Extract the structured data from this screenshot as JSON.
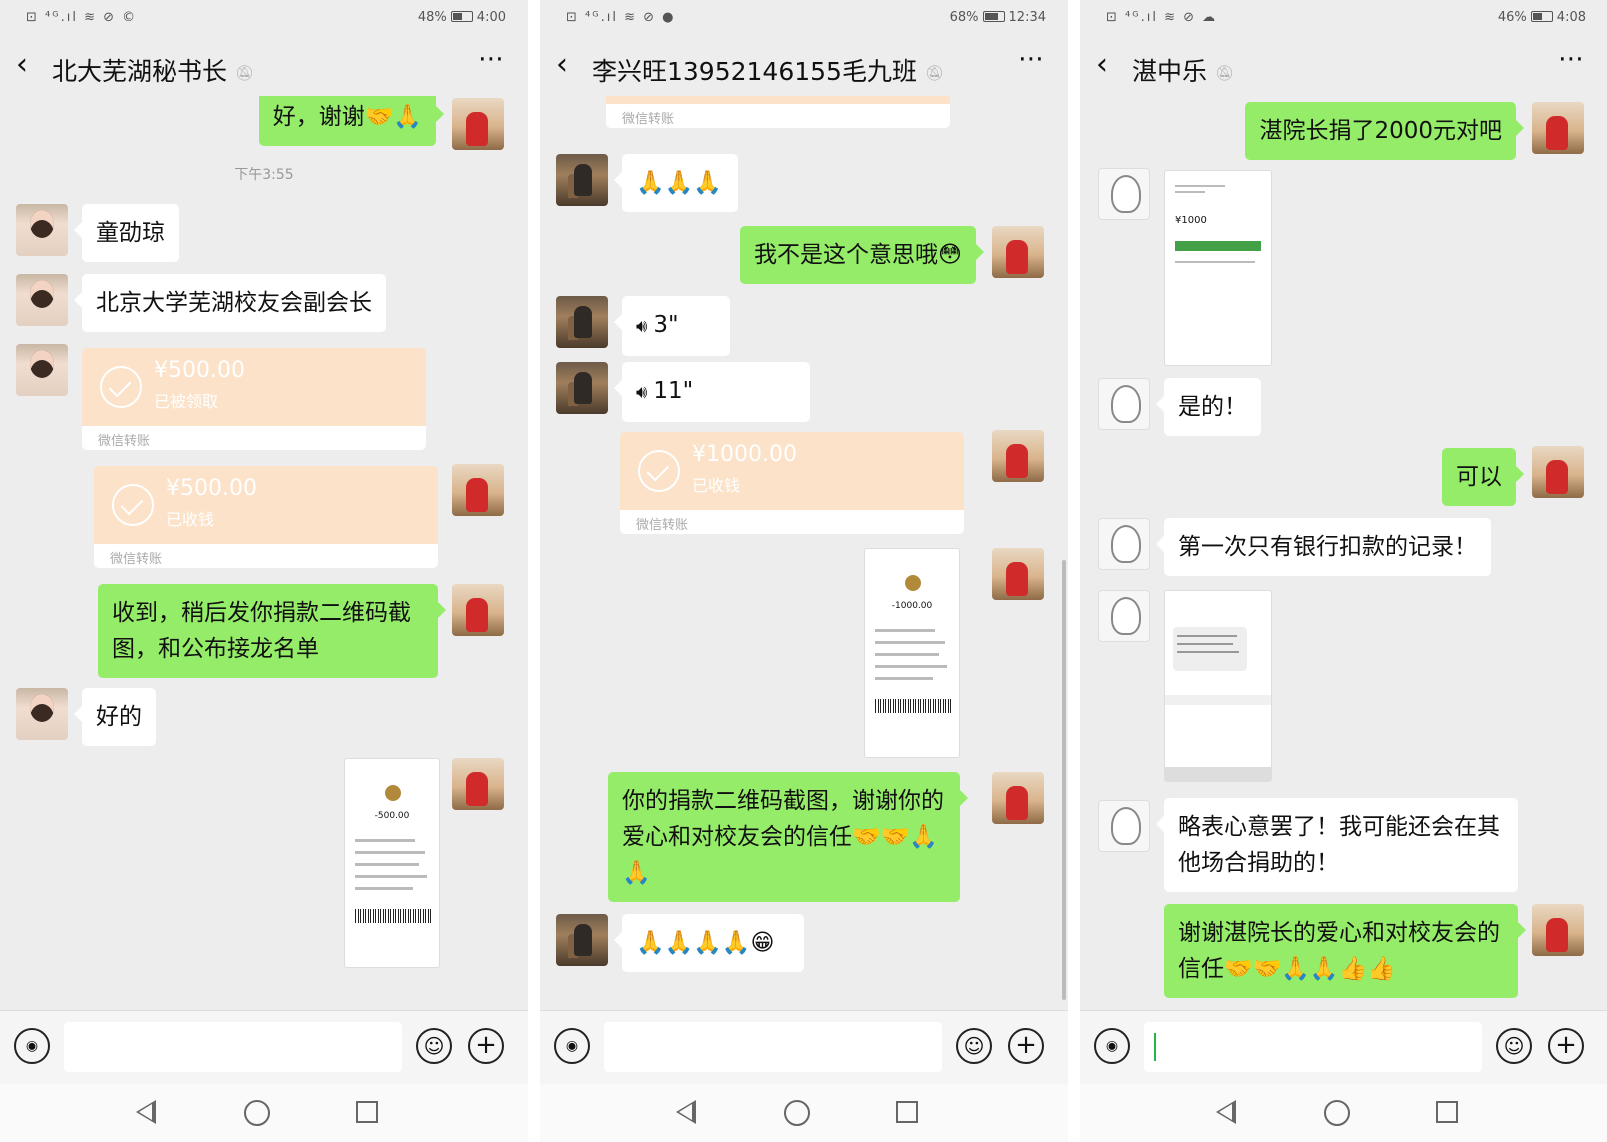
{
  "screens": [
    {
      "status": {
        "icons": "⊡ ⁴ᴳ.ıl ≋ ⊘ ©",
        "battery": "48%",
        "time": "4:00"
      },
      "title": "北大芜湖秘书长",
      "messages": {
        "m1": "好，谢谢🤝🙏",
        "time": "下午3:55",
        "m2": "童劭琼",
        "m3": "北京大学芜湖校友会副会长",
        "t1": {
          "amount": "¥500.00",
          "status": "已被领取",
          "label": "微信转账"
        },
        "t2": {
          "amount": "¥500.00",
          "status": "已收钱",
          "label": "微信转账"
        },
        "m4": "收到，稍后发你捐款二维码截图，和公布接龙名单",
        "m5": "好的"
      },
      "receipt_amount": "-500.00"
    },
    {
      "status": {
        "icons": "⊡ ⁴ᴳ.ıl ≋ ⊘ ●",
        "battery": "68%",
        "time": "12:34"
      },
      "title": "李兴旺13952146155毛九班",
      "messages": {
        "t0": {
          "label": "微信转账"
        },
        "m1": "🙏🙏🙏",
        "m2": "我不是这个意思哦😳",
        "v1": "3\"",
        "v2": "11\"",
        "t1": {
          "amount": "¥1000.00",
          "status": "已收钱",
          "label": "微信转账"
        },
        "m3": "你的捐款二维码截图，谢谢你的爱心和对校友会的信任🤝🤝🙏🙏",
        "m4": "🙏🙏🙏🙏😁"
      },
      "receipt_amount": "-1000.00"
    },
    {
      "status": {
        "icons": "⊡ ⁴ᴳ.ıl ≋ ⊘ ☁",
        "battery": "46%",
        "time": "4:08"
      },
      "title": "湛中乐",
      "messages": {
        "m1": "湛院长捐了2000元对吧",
        "img_amount": "¥1000",
        "m2": "是的！",
        "m3": "可以",
        "m4": "第一次只有银行扣款的记录！",
        "m5": "略表心意罢了！我可能还会在其他场合捐助的！",
        "m6": "谢谢湛院长的爱心和对校友会的信任🤝🤝🙏🙏👍👍"
      }
    }
  ]
}
